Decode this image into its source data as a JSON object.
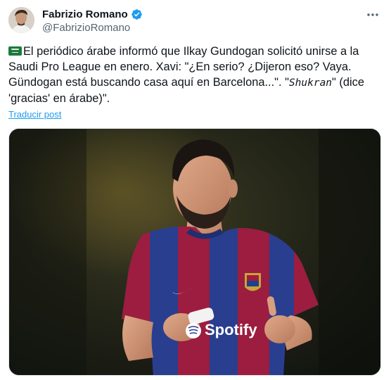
{
  "author": {
    "display_name": "Fabrizio Romano",
    "handle": "@FabrizioRomano",
    "verified": true
  },
  "tweet": {
    "flag_icon": "saudi-flag-icon",
    "part1": "El periódico árabe informó que Ilkay Gundogan solicitó unirse a la Saudi Pro League en enero. Xavi: \"¿En serio? ¿Dijeron eso? Vaya. Gündogan está buscando casa aquí en Barcelona...\". \"",
    "italic_word": "Shukran",
    "part2": "\" (dice 'gracias' en árabe)\"."
  },
  "translate_label": "Traducir post",
  "media": {
    "jersey_sponsor": "Spotify"
  },
  "colors": {
    "link": "#1d9bf0",
    "verified": "#1d9bf0",
    "secondary_text": "#536471",
    "barca_blue": "#2a3e8f",
    "barca_red": "#9c1d3f"
  }
}
